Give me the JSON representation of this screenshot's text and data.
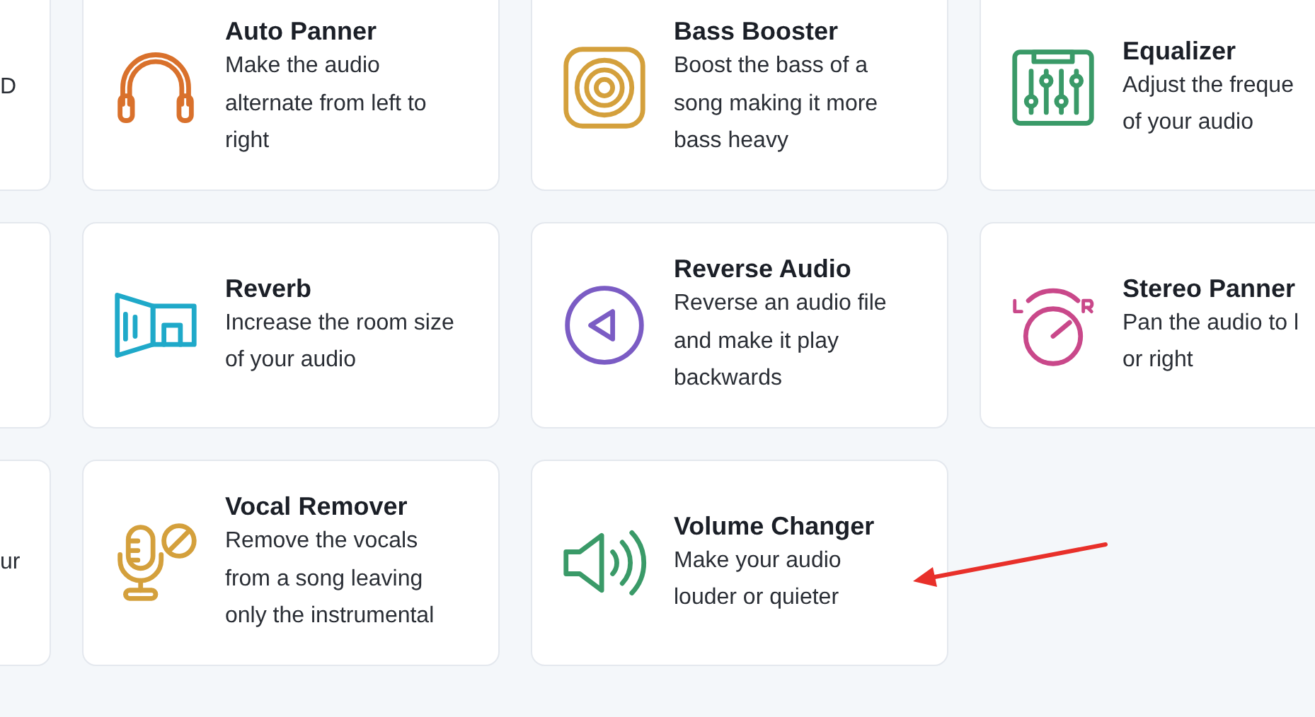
{
  "cards": [
    {
      "kind": "partial",
      "lines": [
        "D"
      ]
    },
    {
      "kind": "headphones",
      "title": "Auto Panner",
      "lines": [
        "Make the audio",
        "alternate from left to",
        "right"
      ]
    },
    {
      "kind": "speaker",
      "title": "Bass Booster",
      "lines": [
        "Boost the bass of a",
        "song making it more",
        "bass heavy"
      ]
    },
    {
      "kind": "equalizer",
      "title": "Equalizer",
      "lines": [
        "Adjust the freque",
        "of your audio"
      ]
    },
    {
      "kind": "partial"
    },
    {
      "kind": "room",
      "title": "Reverb",
      "lines": [
        "Increase the room size",
        "of your audio"
      ]
    },
    {
      "kind": "reverse",
      "title": "Reverse Audio",
      "lines": [
        "Reverse an audio file",
        "and make it play",
        "backwards"
      ]
    },
    {
      "kind": "knob",
      "title": "Stereo Panner",
      "lines": [
        "Pan the audio to l",
        "or right"
      ]
    },
    {
      "kind": "partial",
      "lines": [
        "ur"
      ]
    },
    {
      "kind": "mic",
      "title": "Vocal Remover",
      "lines": [
        "Remove the vocals",
        "from a song leaving",
        "only the instrumental"
      ]
    },
    {
      "kind": "volume",
      "title": "Volume Changer",
      "lines": [
        "Make your audio",
        "louder or quieter"
      ]
    }
  ]
}
